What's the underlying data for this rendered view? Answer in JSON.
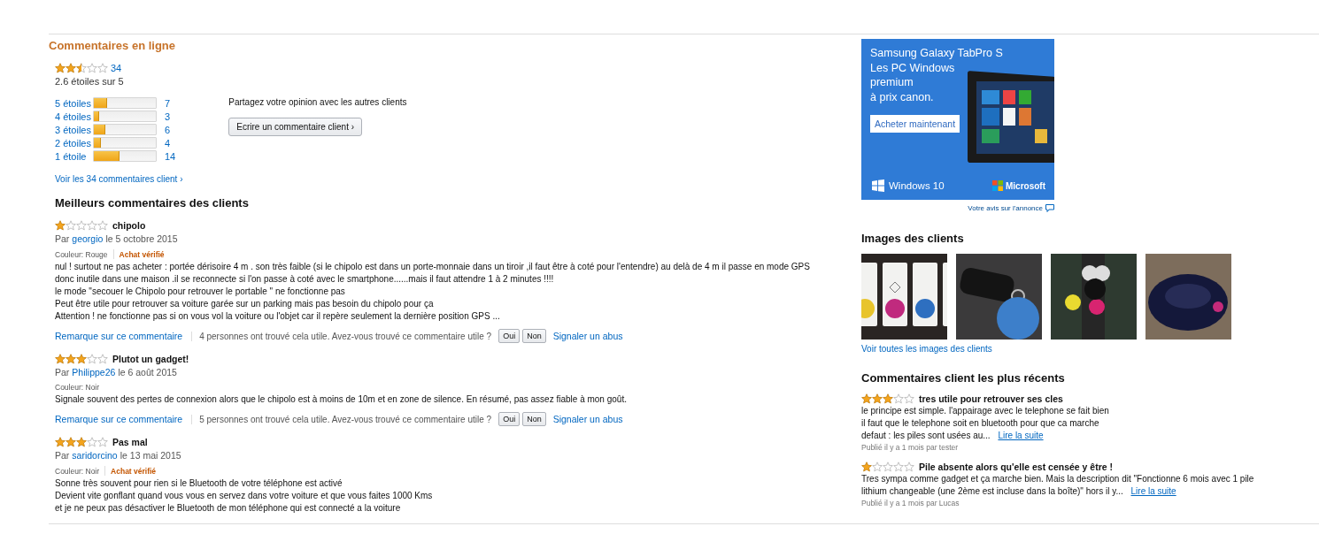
{
  "title": "Commentaires en ligne",
  "summary": {
    "stars": 2.5,
    "count": "34",
    "average": "2.6 étoiles sur 5"
  },
  "histogram": [
    {
      "label": "5 étoiles",
      "level": 0.21,
      "count": "7"
    },
    {
      "label": "4 étoiles",
      "level": 0.09,
      "count": "3"
    },
    {
      "label": "3 étoiles",
      "level": 0.18,
      "count": "6"
    },
    {
      "label": "2 étoiles",
      "level": 0.12,
      "count": "4"
    },
    {
      "label": "1 étoile",
      "level": 0.41,
      "count": "14"
    }
  ],
  "share": {
    "text": "Partagez votre opinion avec les autres clients",
    "button": "Ecrire un commentaire client",
    "chevron": "›"
  },
  "see_all": {
    "text": "Voir les 34 commentaires client",
    "chevron": "›"
  },
  "top_reviews": {
    "heading": "Meilleurs commentaires des clients",
    "reviews": [
      {
        "stars": 1,
        "title": "chipolo",
        "by": "Par",
        "author": "georgio",
        "date": "le 5 octobre 2015",
        "variant": "Couleur: Rouge",
        "verified": "Achat vérifié",
        "lines": [
          "nul ! surtout ne pas acheter : portée dérisoire 4 m . son très faible (si le chipolo est dans un porte-monnaie dans un tiroir ,il faut être à coté pour l'entendre) au delà de 4 m il passe en mode GPS",
          "donc inutile dans une maison .il se reconnecte si l'on passe à coté avec le smartphone......mais il faut attendre 1 à 2 minutes !!!!",
          "le mode \"secouer le Chipolo pour retrouver le portable \" ne fonctionne pas",
          "Peut être utile pour retrouver sa voiture garée sur un parking mais pas besoin du chipolo pour ça",
          "Attention ! ne fonctionne pas si on vous vol la voiture ou l'objet car il repère seulement la dernière position GPS ..."
        ],
        "footer": {
          "comment_link": "Remarque sur ce commentaire",
          "helpful": "4 personnes ont trouvé cela utile. Avez-vous trouvé ce commentaire utile ?",
          "yes": "Oui",
          "no": "Non",
          "report": "Signaler un abus"
        }
      },
      {
        "stars": 3,
        "title": "Plutot un gadget!",
        "by": "Par",
        "author": "Philippe26",
        "date": "le 6 août 2015",
        "variant": "Couleur: Noir",
        "lines": [
          "Signale souvent des pertes de connexion alors que le chipolo est à moins de 10m et en zone de silence. En résumé, pas assez fiable à mon goût."
        ],
        "footer": {
          "comment_link": "Remarque sur ce commentaire",
          "helpful": "5 personnes ont trouvé cela utile. Avez-vous trouvé ce commentaire utile ?",
          "yes": "Oui",
          "no": "Non",
          "report": "Signaler un abus"
        }
      },
      {
        "stars": 3,
        "title": "Pas mal",
        "by": "Par",
        "author": "saridorcino",
        "date": "le 13 mai 2015",
        "variant": "Couleur: Noir",
        "verified": "Achat vérifié",
        "lines": [
          "Sonne très souvent pour rien si le Bluetooth de votre téléphone est activé",
          "Devient vite gonflant quand vous vous en servez dans votre voiture et que vous faites 1000 Kms",
          "et je ne peux pas désactiver le Bluetooth de mon téléphone qui est connecté a la voiture"
        ]
      }
    ]
  },
  "ad": {
    "lines": [
      "Samsung Galaxy TabPro S",
      "Les PC Windows",
      "premium",
      "à prix canon."
    ],
    "button": "Acheter maintenant",
    "os": "Windows 10",
    "brand": "Microsoft",
    "feedback": "Votre avis sur l'annonce"
  },
  "customer_images": {
    "heading": "Images des clients",
    "link": "Voir toutes les images des clients"
  },
  "recent_reviews": {
    "heading": "Commentaires client les plus récents",
    "reviews": [
      {
        "stars": 3,
        "title": "tres utile pour retrouver ses cles",
        "lines": [
          "le principe est simple. l'appairage avec le telephone se fait bien",
          "il faut que le telephone soit en bluetooth pour que ca marche",
          "defaut : les piles sont usées au..."
        ],
        "more": "Lire la suite",
        "published": "Publié il y a 1 mois par tester"
      },
      {
        "stars": 1,
        "title": "Pile absente alors qu'elle est censée y être !",
        "lines": [
          "Tres sympa comme gadget et ça marche bien. Mais la description dit \"Fonctionne 6 mois avec 1 pile",
          "lithium changeable (une 2ème est incluse dans la boîte)\" hors il y..."
        ],
        "more": "Lire la suite",
        "published": "Publié il y a 1 mois par Lucas"
      }
    ]
  }
}
